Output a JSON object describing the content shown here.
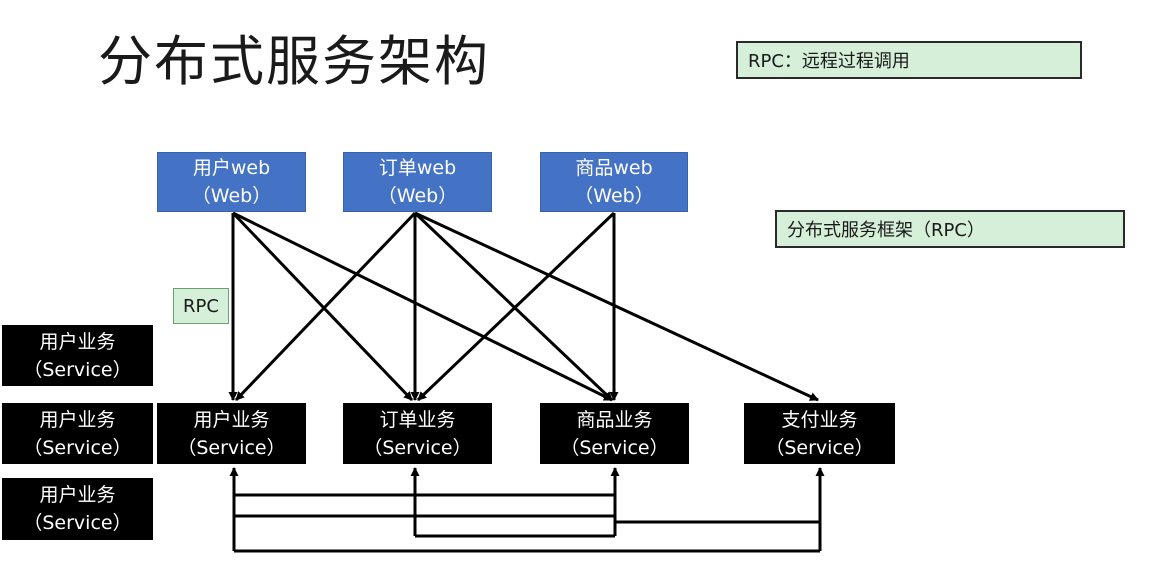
{
  "title": "分布式服务架构",
  "notes": {
    "rpc_definition": "RPC：远程过程调用",
    "rpc_framework": "分布式服务框架（RPC）"
  },
  "rpc_label": "RPC",
  "web_nodes": [
    {
      "name": "用户web",
      "type": "（Web）"
    },
    {
      "name": "订单web",
      "type": "（Web）"
    },
    {
      "name": "商品web",
      "type": "（Web）"
    }
  ],
  "service_nodes": [
    {
      "name": "用户业务",
      "type": "（Service）"
    },
    {
      "name": "订单业务",
      "type": "（Service）"
    },
    {
      "name": "商品业务",
      "type": "（Service）"
    },
    {
      "name": "支付业务",
      "type": "（Service）"
    }
  ],
  "replica_nodes": [
    {
      "name": "用户业务",
      "type": "（Service）"
    },
    {
      "name": "用户业务",
      "type": "（Service）"
    },
    {
      "name": "用户业务",
      "type": "（Service）"
    }
  ],
  "colors": {
    "web": "#4472c4",
    "service": "#000000",
    "note": "#d6efd9"
  }
}
